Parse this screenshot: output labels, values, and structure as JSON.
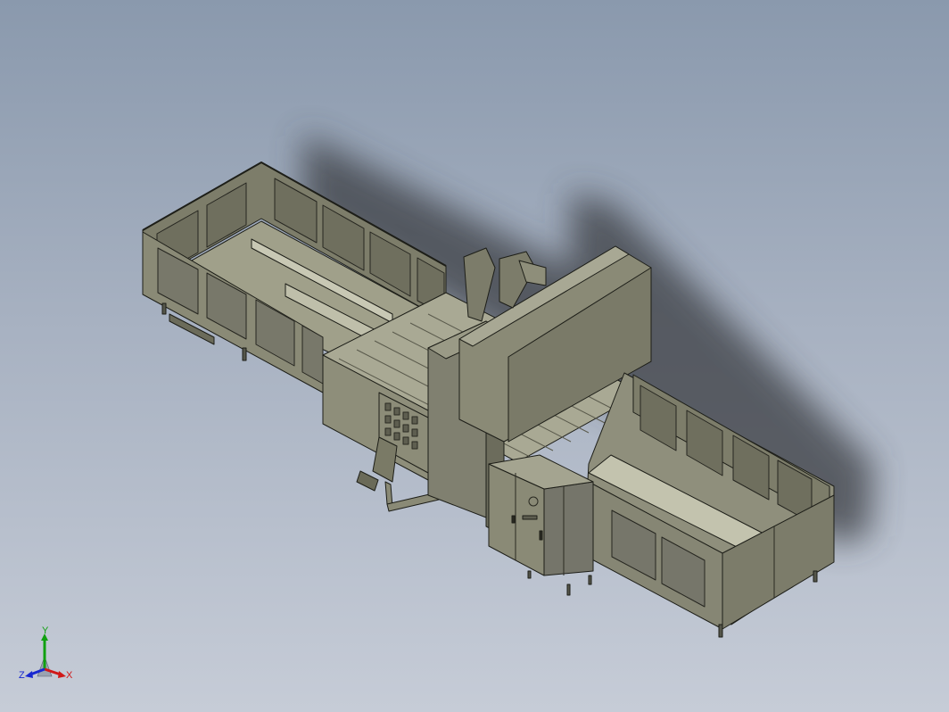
{
  "viewport": {
    "background_top": "#8a99ad",
    "background_bottom": "#c6ccd7",
    "model": "gantry-machine-enclosure",
    "shadow": true
  },
  "triad": {
    "x_label": "X",
    "y_label": "Y",
    "z_label": "Z",
    "x_color": "#d01818",
    "y_color": "#10a010",
    "z_color": "#1828d0"
  }
}
